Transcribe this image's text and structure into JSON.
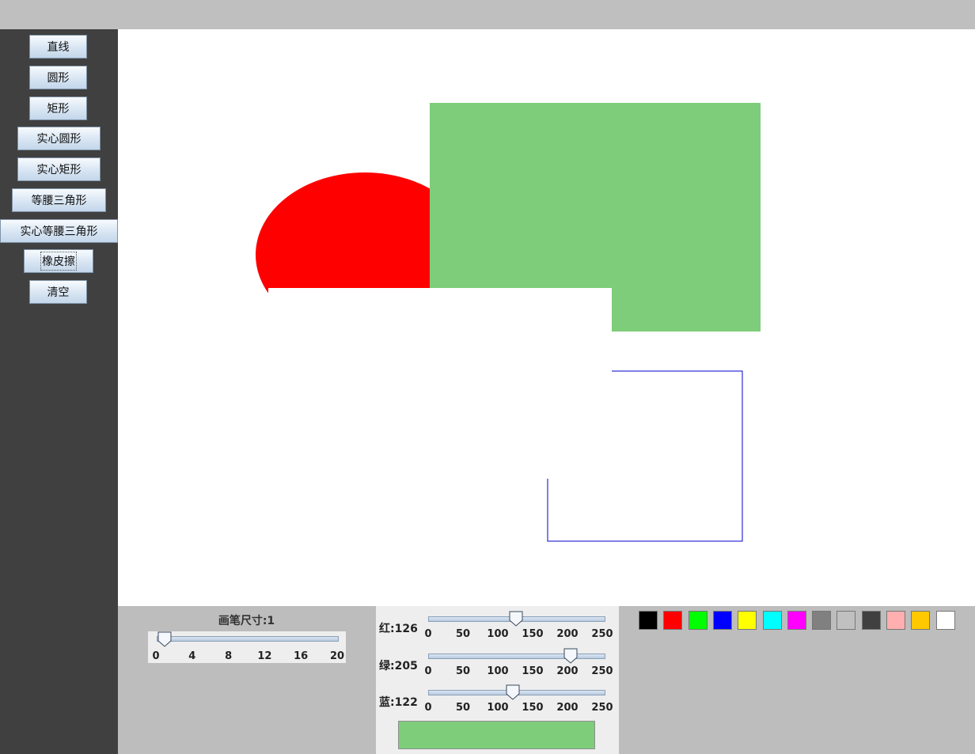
{
  "tools": [
    {
      "id": "line",
      "label": "直线"
    },
    {
      "id": "circle",
      "label": "圆形"
    },
    {
      "id": "rect",
      "label": "矩形"
    },
    {
      "id": "filled-circle",
      "label": "实心圆形"
    },
    {
      "id": "filled-rect",
      "label": "实心矩形"
    },
    {
      "id": "triangle",
      "label": "等腰三角形"
    },
    {
      "id": "filled-triangle",
      "label": "实心等腰三角形"
    },
    {
      "id": "eraser",
      "label": "橡皮擦"
    },
    {
      "id": "clear",
      "label": "清空"
    }
  ],
  "brush": {
    "label": "画笔尺寸:1",
    "value": 1,
    "min": 0,
    "max": 20,
    "ticks": [
      "0",
      "4",
      "8",
      "12",
      "16",
      "20"
    ]
  },
  "rgb": {
    "ticks": [
      "0",
      "50",
      "100",
      "150",
      "200",
      "250"
    ],
    "max": 255,
    "red": {
      "label": "红:126",
      "value": 126
    },
    "green": {
      "label": "绿:205",
      "value": 205
    },
    "blue": {
      "label": "蓝:122",
      "value": 122
    },
    "preview_color": "#7ecd7a"
  },
  "palette": [
    "#000000",
    "#ff0000",
    "#00ff00",
    "#0000ff",
    "#ffff00",
    "#00ffff",
    "#ff00ff",
    "#808080",
    "#c0c0c0",
    "#404040",
    "#ffafaf",
    "#ffc800",
    "#ffffff"
  ],
  "canvas_colors": {
    "red_shape": "#ff0000",
    "green_rect": "#7ecd7a",
    "blue_outline": "#0000cc"
  }
}
